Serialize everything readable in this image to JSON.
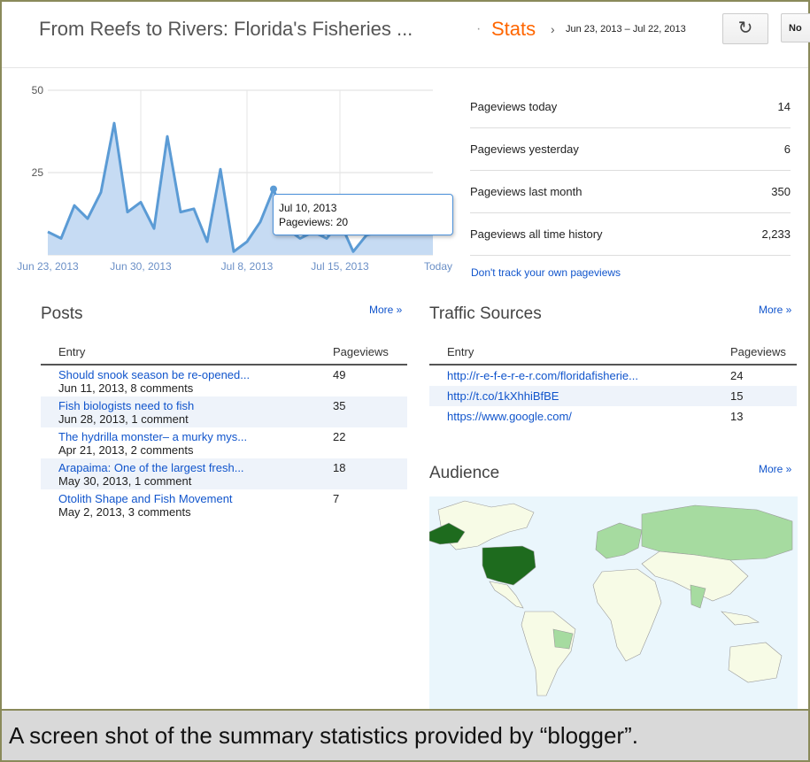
{
  "header": {
    "blog_title": "From Reefs to Rivers: Florida's Fisheries ...",
    "separator": "·",
    "section": "Stats",
    "arrow": "›",
    "date_range": "Jun 23, 2013 – Jul 22, 2013",
    "refresh_icon": "refresh-icon",
    "now_label": "No"
  },
  "chart_data": {
    "type": "area",
    "title": "",
    "xlabel": "",
    "ylabel": "Pageviews",
    "ylim": [
      0,
      50
    ],
    "yticks": [
      "50",
      "25"
    ],
    "xtick_labels": [
      "Jun 23, 2013",
      "Jun 30, 2013",
      "Jul 8, 2013",
      "Jul 15, 2013",
      "Today"
    ],
    "x": [
      "Jun 23",
      "Jun 24",
      "Jun 25",
      "Jun 26",
      "Jun 27",
      "Jun 28",
      "Jun 29",
      "Jun 30",
      "Jul 1",
      "Jul 2",
      "Jul 3",
      "Jul 4",
      "Jul 5",
      "Jul 6",
      "Jul 7",
      "Jul 8",
      "Jul 9",
      "Jul 10",
      "Jul 11",
      "Jul 12",
      "Jul 13",
      "Jul 14",
      "Jul 15",
      "Jul 16",
      "Jul 17",
      "Jul 18",
      "Jul 19",
      "Jul 20",
      "Jul 21",
      "Jul 22"
    ],
    "series": [
      {
        "values": [
          7,
          5,
          15,
          11,
          19,
          40,
          13,
          16,
          8,
          36,
          13,
          14,
          4,
          26,
          1,
          4,
          10,
          20,
          8,
          5,
          7,
          5,
          10,
          1,
          6,
          7,
          8,
          9,
          10,
          14
        ]
      }
    ],
    "color": "#5b9bd5",
    "fill": "#c6dbf3",
    "grid": true,
    "tooltip": {
      "date": "Jul 10, 2013",
      "label": "Pageviews: 20"
    }
  },
  "summary": {
    "rows": [
      {
        "label": "Pageviews today",
        "value": "14"
      },
      {
        "label": "Pageviews yesterday",
        "value": "6"
      },
      {
        "label": "Pageviews last month",
        "value": "350"
      },
      {
        "label": "Pageviews all time history",
        "value": "2,233"
      }
    ],
    "dont_track": "Don't track your own pageviews"
  },
  "posts": {
    "title": "Posts",
    "more": "More »",
    "col_entry": "Entry",
    "col_pageviews": "Pageviews",
    "rows": [
      {
        "title": "Should snook season be re-opened...",
        "meta": "Jun 11, 2013, 8 comments",
        "views": "49"
      },
      {
        "title": "Fish biologists need to fish",
        "meta": "Jun 28, 2013, 1 comment",
        "views": "35"
      },
      {
        "title": "The hydrilla monster– a murky mys...",
        "meta": "Apr 21, 2013, 2 comments",
        "views": "22"
      },
      {
        "title": "Arapaima: One of the largest fresh...",
        "meta": "May 30, 2013, 1 comment",
        "views": "18"
      },
      {
        "title": "Otolith Shape and Fish Movement",
        "meta": "May 2, 2013, 3 comments",
        "views": "7"
      }
    ]
  },
  "traffic": {
    "title": "Traffic Sources",
    "more": "More »",
    "col_entry": "Entry",
    "col_pageviews": "Pageviews",
    "rows": [
      {
        "url": "http://r-e-f-e-r-e-r.com/floridafisherie...",
        "views": "24"
      },
      {
        "url": "http://t.co/1kXhhiBfBE",
        "views": "15"
      },
      {
        "url": "https://www.google.com/",
        "views": "13"
      }
    ]
  },
  "audience": {
    "title": "Audience",
    "more": "More »",
    "map_icon": "world-map",
    "colors": {
      "ocean": "#eaf6fc",
      "high": "#1e6b1e",
      "mid": "#a6dba0",
      "low": "#f7fbe6",
      "border": "#9a9a9a"
    }
  },
  "caption": "A screen shot of the summary statistics provided by “blogger”."
}
